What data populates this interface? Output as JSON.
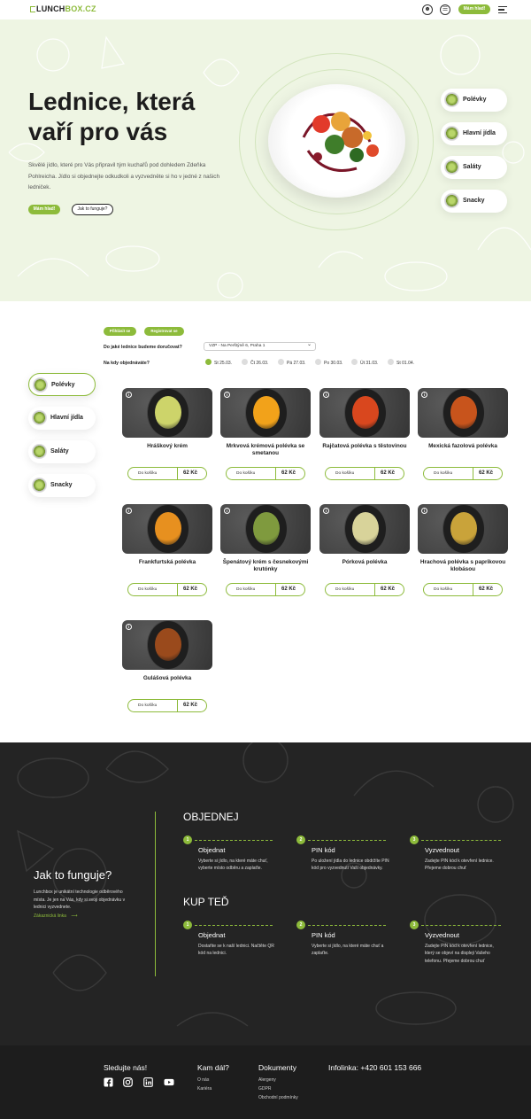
{
  "header": {
    "logo_part1": "LUNCH",
    "logo_part2": "BOX.CZ",
    "cta": "Mám hlad!",
    "icons": [
      "user-icon",
      "menu-list-icon",
      "hamburger-icon"
    ]
  },
  "hero": {
    "title_line1": "Lednice, která",
    "title_line2": "vaří pro vás",
    "description": "Skvělé jídlo, které pro Vás připravil tým kuchařů pod dohledem Zdeňka Pohlreicha. Jídlo si objednejte odkudkoli a vyzvedněte si ho v jedné z našich ledniček.",
    "primary_button": "Mám hlad!",
    "secondary_button": "Jak to funguje?",
    "categories": [
      "Polévky",
      "Hlavní jídla",
      "Saláty",
      "Snacky"
    ]
  },
  "filters": {
    "login_button": "Přihlásit se",
    "register_button": "Registrovat se",
    "fridge_question": "Do jaké lednice budeme doručovat?",
    "fridge_value": "VZP - Na Perštýně 6, Praha 1",
    "date_question": "Na kdy objednáváte?",
    "days": [
      "St 25.03.",
      "Čt 26.03.",
      "Pá 27.03.",
      "Po 30.03.",
      "Út 31.03.",
      "St 01.04."
    ],
    "active_day": 0
  },
  "sidebar": {
    "categories": [
      "Polévky",
      "Hlavní jídla",
      "Saláty",
      "Snacky"
    ],
    "active": 0
  },
  "products": {
    "buy_label": "Do košíku",
    "items": [
      {
        "name": "Hráškový krém",
        "price": "62 Kč",
        "color": "#cdd46a"
      },
      {
        "name": "Mrkvová krémová polévka se smetanou",
        "price": "62 Kč",
        "color": "#f2a21a"
      },
      {
        "name": "Rajčatová polévka s těstovinou",
        "price": "62 Kč",
        "color": "#d9471e"
      },
      {
        "name": "Mexická fazolová polévka",
        "price": "62 Kč",
        "color": "#c8541c"
      },
      {
        "name": "Frankfurtská polévka",
        "price": "62 Kč",
        "color": "#e7901f"
      },
      {
        "name": "Špenátový krém s česnekovými krutónky",
        "price": "62 Kč",
        "color": "#7f9a3e"
      },
      {
        "name": "Pórková polévka",
        "price": "62 Kč",
        "color": "#d8d39a"
      },
      {
        "name": "Hrachová polévka s paprikovou klobásou",
        "price": "62 Kč",
        "color": "#c9a33a"
      },
      {
        "name": "Gulášová polévka",
        "price": "62 Kč",
        "color": "#9a4a1c"
      }
    ]
  },
  "how": {
    "title": "Jak to funguje?",
    "text": "Lunchbox je unikátní technologie odběrového místa. Je jen na Vás, kdy si svoji objednávku v lednici vyzvednete.",
    "link": "Zákaznická linka",
    "order_title": "OBJEDNEJ",
    "order_steps": [
      {
        "n": "1",
        "title": "Objednat",
        "text": "Vyberte si jídlo, na které máte chuť, vyberte místo odběru a zaplaťte."
      },
      {
        "n": "2",
        "title": "PIN kód",
        "text": "Po uložení jídla do lednice obdržíte PIN kód pro vyzvednutí Vaší objednávky."
      },
      {
        "n": "3",
        "title": "Vyzvednout",
        "text": "Zadejte PIN kód k otevření lednice. Přejeme dobrou chuť"
      }
    ],
    "buy_title": "KUP TEĎ",
    "buy_steps": [
      {
        "n": "1",
        "title": "Objednat",
        "text": "Dostaňte se k naší lednici. Načtěte QR kód na lednici."
      },
      {
        "n": "2",
        "title": "PIN kód",
        "text": "Vyberte si jídlo, na které máte chuť a zaplaťte."
      },
      {
        "n": "3",
        "title": "Vyzvednout",
        "text": "Zadejte PIN kód k otevření lednice, který se objeví na displeji Vašeho telefonu. Přejeme dobrou chuť"
      }
    ]
  },
  "footer": {
    "follow": "Sledujte nás!",
    "social_icons": [
      "facebook-icon",
      "instagram-icon",
      "linkedin-icon",
      "youtube-icon"
    ],
    "next_title": "Kam dál?",
    "next_links": [
      "O nás",
      "Kariéra"
    ],
    "docs_title": "Dokumenty",
    "docs_links": [
      "Alergeny",
      "GDPR",
      "Obchodní podmínky"
    ],
    "infoline": "Infolinka: +420 601 153 666"
  }
}
